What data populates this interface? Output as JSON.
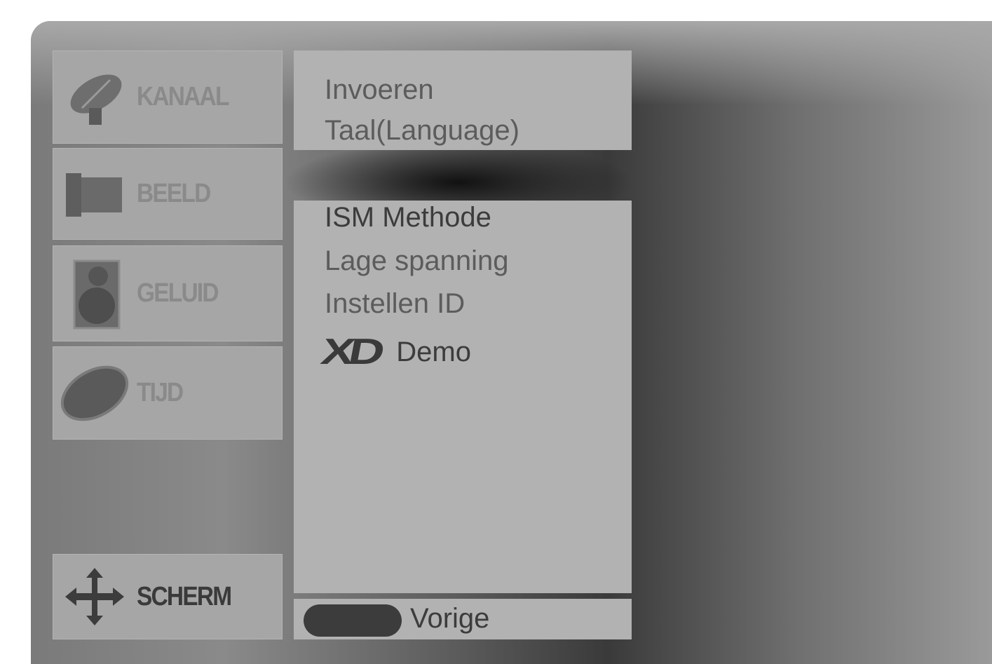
{
  "sidebar": {
    "items": [
      {
        "label": "KANAAL",
        "icon": "satellite-dish-icon"
      },
      {
        "label": "BEELD",
        "icon": "picture-screen-icon"
      },
      {
        "label": "GELUID",
        "icon": "speaker-icon"
      },
      {
        "label": "TIJD",
        "icon": "clock-icon"
      }
    ],
    "active_item": {
      "label": "SCHERM",
      "icon": "move-arrows-icon"
    }
  },
  "menu": {
    "top_items": [
      "Invoeren",
      "Taal(Language)"
    ],
    "items": [
      "ISM Methode",
      "Lage spanning",
      "Instellen ID"
    ],
    "demo": {
      "logo": "XD",
      "label": "Demo"
    }
  },
  "footer": {
    "button_color": "#3c3c3c",
    "back_label": "Vorige"
  }
}
